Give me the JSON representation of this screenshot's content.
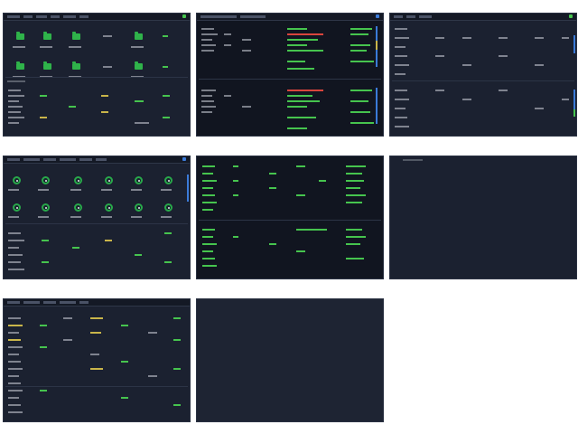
{
  "thumbnails": [
    {
      "label": "dashboard-file-grid"
    },
    {
      "label": "dashboard-log-table"
    },
    {
      "label": "dashboard-sparse-table"
    },
    {
      "label": "dashboard-gauges"
    },
    {
      "label": "dashboard-terminal-list"
    },
    {
      "label": "dashboard-empty"
    },
    {
      "label": "dashboard-resource-table"
    },
    {
      "label": "dashboard-blank"
    }
  ],
  "colors": {
    "panel": "#1b2130",
    "panel_dark": "#111520",
    "accent_green": "#46c44e",
    "accent_red": "#d9453d",
    "accent_yellow": "#c9b54a",
    "accent_blue": "#3b7bd8"
  }
}
